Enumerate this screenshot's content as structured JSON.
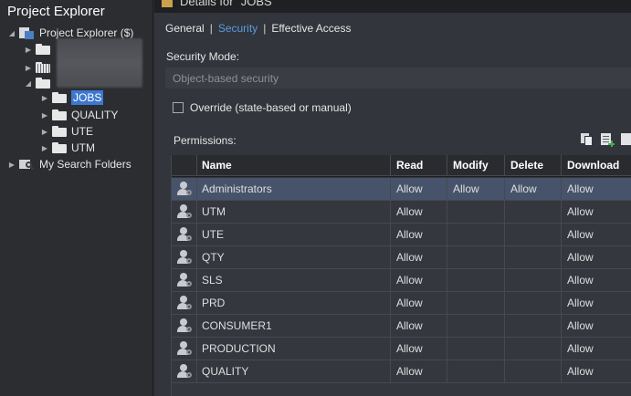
{
  "left_panel": {
    "title": "Project Explorer",
    "root_label": "Project Explorer ($)",
    "folders": [
      "JOBS",
      "QUALITY",
      "UTE",
      "UTM"
    ],
    "search_label": "My Search Folders"
  },
  "dialog": {
    "title": "Details for \"JOBS\"",
    "tabs": [
      {
        "label": "General"
      },
      {
        "label": "Security"
      },
      {
        "label": "Effective Access"
      }
    ],
    "security_mode_label": "Security Mode:",
    "security_mode_value": "Object-based security",
    "override_label": "Override (state-based or manual)",
    "permissions_label": "Permissions:"
  },
  "grid": {
    "columns": [
      "Name",
      "Read",
      "Modify",
      "Delete",
      "Download"
    ],
    "rows": [
      {
        "name": "Administrators",
        "read": "Allow",
        "modify": "Allow",
        "delete": "Allow",
        "download": "Allow"
      },
      {
        "name": "UTM",
        "read": "Allow",
        "modify": "",
        "delete": "",
        "download": "Allow"
      },
      {
        "name": "UTE",
        "read": "Allow",
        "modify": "",
        "delete": "",
        "download": "Allow"
      },
      {
        "name": "QTY",
        "read": "Allow",
        "modify": "",
        "delete": "",
        "download": "Allow"
      },
      {
        "name": "SLS",
        "read": "Allow",
        "modify": "",
        "delete": "",
        "download": "Allow"
      },
      {
        "name": "PRD",
        "read": "Allow",
        "modify": "",
        "delete": "",
        "download": "Allow"
      },
      {
        "name": "CONSUMER1",
        "read": "Allow",
        "modify": "",
        "delete": "",
        "download": "Allow"
      },
      {
        "name": "PRODUCTION",
        "read": "Allow",
        "modify": "",
        "delete": "",
        "download": "Allow"
      },
      {
        "name": "QUALITY",
        "read": "Allow",
        "modify": "",
        "delete": "",
        "download": "Allow"
      }
    ]
  },
  "colors": {
    "accent": "#5b9be0",
    "selection": "#3d77d0",
    "selected_row": "#47536a"
  }
}
